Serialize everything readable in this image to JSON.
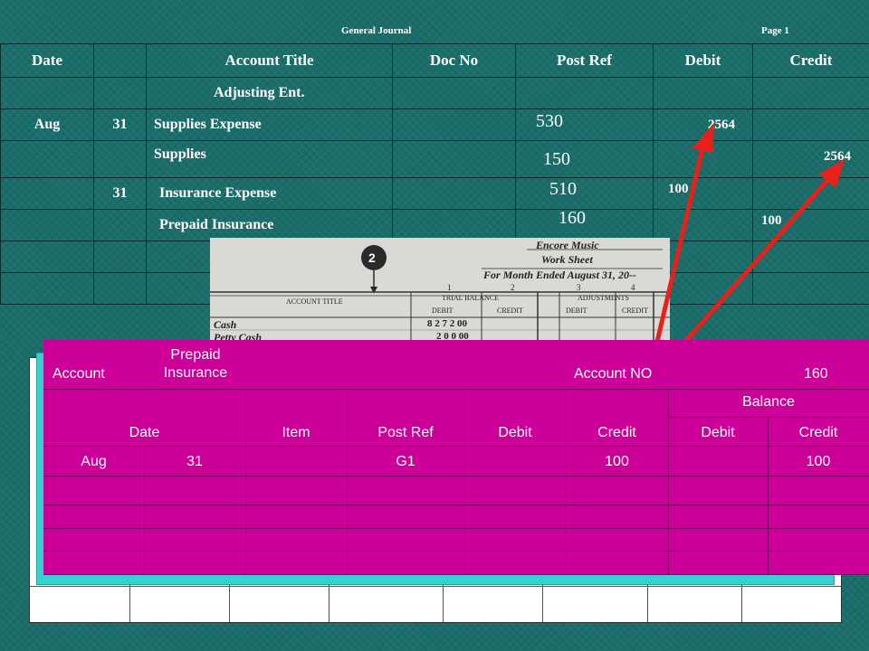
{
  "journal": {
    "title": "General Journal",
    "page": "Page 1",
    "headers": [
      "Date",
      "",
      "Account Title",
      "Doc No",
      "Post Ref",
      "Debit",
      "Credit"
    ],
    "rows": [
      {
        "month": "",
        "day": "",
        "title": "Adjusting Ent.",
        "doc": "",
        "ref": "",
        "debit": "",
        "credit": ""
      },
      {
        "month": "Aug",
        "day": "31",
        "title": "Supplies Expense",
        "doc": "",
        "ref": "530",
        "debit": "2564",
        "credit": ""
      },
      {
        "month": "",
        "day": "",
        "title": "Supplies",
        "doc": "",
        "ref": "150",
        "debit": "",
        "credit": "2564"
      },
      {
        "month": "",
        "day": "31",
        "title": "Insurance Expense",
        "doc": "",
        "ref": "510",
        "debit": "100",
        "credit": ""
      },
      {
        "month": "",
        "day": "",
        "title": "Prepaid Insurance",
        "doc": "",
        "ref": "160",
        "debit": "",
        "credit": "100"
      }
    ]
  },
  "worksheet": {
    "badge": "2",
    "company": "Encore Music",
    "name": "Work Sheet",
    "period": "For Month Ended August 31, 20--",
    "col_nums": [
      "1",
      "2",
      "3",
      "4"
    ],
    "account_title": "ACCOUNT TITLE",
    "trial_balance": "TRIAL BALANCE",
    "adjustments": "ADJUSTMENTS",
    "debit": "DEBIT",
    "credit": "CREDIT",
    "accounts": [
      "Cash",
      "Petty Cash"
    ],
    "amounts": [
      "8 2 7 2 00",
      "2 0 0 00"
    ]
  },
  "ledger": {
    "account_label": "Account",
    "account_name": "Prepaid\nInsurance",
    "account_no_label": "Account NO",
    "account_no": "160",
    "balance": "Balance",
    "headers": [
      "Date",
      "Item",
      "Post Ref",
      "Debit",
      "Credit",
      "Debit",
      "Credit"
    ],
    "row": {
      "month": "Aug",
      "day": "31",
      "item": "",
      "ref": "G1",
      "debit": "",
      "credit": "100",
      "bal_debit": "",
      "bal_credit": "100"
    }
  },
  "colors": {
    "arrow": "#e8201a",
    "magenta": "#cc0099",
    "cyan": "#38d0d0",
    "teal": "#1a6d6a"
  }
}
